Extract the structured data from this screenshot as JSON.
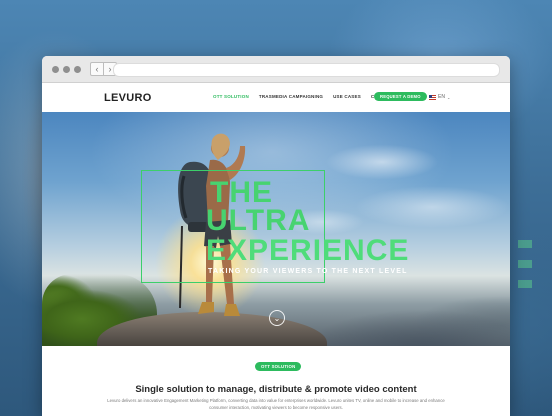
{
  "site": {
    "logo": "LEVURO",
    "nav": [
      {
        "label": "OTT SOLUTION",
        "active": true
      },
      {
        "label": "TRASMEDIA CAMPAIGNING",
        "active": false
      },
      {
        "label": "USE CASES",
        "active": false
      },
      {
        "label": "COMPANY",
        "active": false
      }
    ],
    "demo_button": "REQUEST A DEMO",
    "language": "EN",
    "language_icon": "us-flag-icon",
    "accent_color": "#2dbb5e"
  },
  "hero": {
    "line1": "THE",
    "line2": "ULTRA",
    "line3": "EXPERIENCE",
    "tagline": "TAKING YOUR VIEWERS TO THE NEXT LEVEL",
    "scroll_icon": "chevron-down-icon",
    "headline_color": "#47d370"
  },
  "section": {
    "badge": "OTT SOLUTION",
    "title": "Single solution to manage, distribute & promote video content",
    "body": "Levuro delivers an innovative Engagement Marketing Platform, converting data into value for enterprises worldwide. Levuro unites TV, online and mobile to increase and enhance consumer interaction, motivating viewers to become responsive users."
  },
  "browser": {
    "back_icon": "chevron-left-icon",
    "forward_icon": "chevron-right-icon",
    "url": ""
  }
}
